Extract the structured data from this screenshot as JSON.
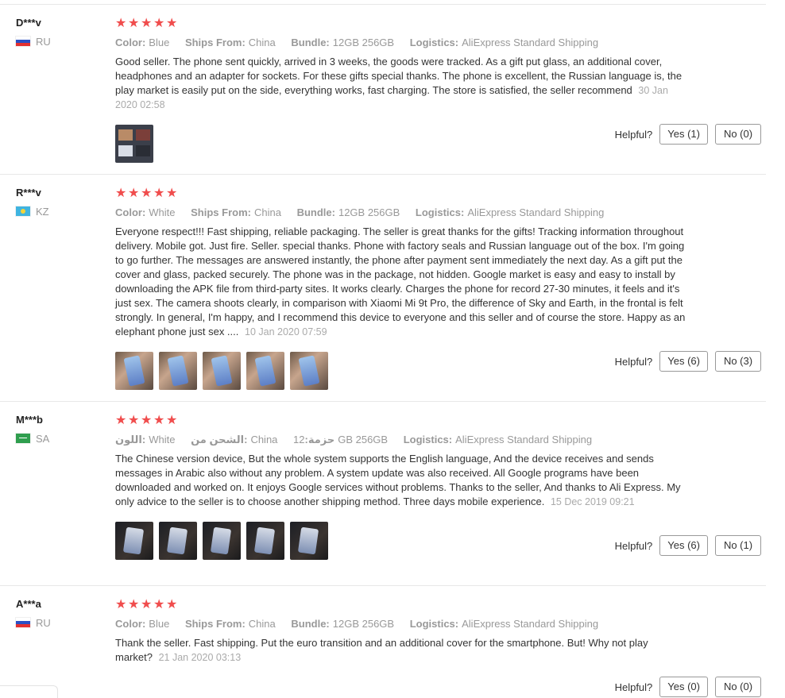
{
  "helpful_label": "Helpful?",
  "stars_glyph": "★",
  "reviews": [
    {
      "user": "D***v",
      "country": "RU",
      "flag": "russia-flag",
      "meta": [
        {
          "key": "Color:",
          "value": "Blue"
        },
        {
          "key": "Ships From:",
          "value": "China"
        },
        {
          "key": "Bundle:",
          "value": "12GB 256GB"
        },
        {
          "key": "Logistics:",
          "value": "AliExpress Standard Shipping"
        }
      ],
      "text": "Good seller. The phone sent quickly, arrived in 3 weeks, the goods were tracked. As a gift put glass, an additional cover, headphones and an adapter for sockets. For these gifts special thanks. The phone is excellent, the Russian language is, the play market is easily put on the side, everything works, fast charging. The store is satisfied, the seller recommend",
      "date": "30 Jan 2020 02:58",
      "photos": 1,
      "yes": "Yes (1)",
      "no": "No (0)"
    },
    {
      "user": "R***v",
      "country": "KZ",
      "flag": "kazakhstan-flag",
      "meta": [
        {
          "key": "Color:",
          "value": "White"
        },
        {
          "key": "Ships From:",
          "value": "China"
        },
        {
          "key": "Bundle:",
          "value": "12GB 256GB"
        },
        {
          "key": "Logistics:",
          "value": "AliExpress Standard Shipping"
        }
      ],
      "text": "Everyone respect!!! Fast shipping, reliable packaging. The seller is great thanks for the gifts! Tracking information throughout delivery. Mobile got. Just fire. Seller. special thanks. Phone with factory seals and Russian language out of the box. I'm going to go further. The messages are answered instantly, the phone after payment sent immediately the next day. As a gift put the cover and glass, packed securely. The phone was in the package, not hidden. Google market is easy and easy to install by downloading the APK file from third-party sites. It works clearly. Charges the phone for record 27-30 minutes, it feels and it's just sex. The camera shoots clearly, in comparison with Xiaomi Mi 9t Pro, the difference of Sky and Earth, in the frontal is felt strongly. In general, I'm happy, and I recommend this device to everyone and this seller and of course the store. Happy as an elephant phone just sex ....",
      "date": "10 Jan 2020 07:59",
      "photos": 5,
      "yes": "Yes (6)",
      "no": "No (3)"
    },
    {
      "user": "M***b",
      "country": "SA",
      "flag": "saudi-arabia-flag",
      "meta": [
        {
          "key": "اللون:",
          "value": "White"
        },
        {
          "key": "الشحن من:",
          "value": "China"
        },
        {
          "key": "حزمة:",
          "value": "12GB 256GB"
        },
        {
          "key": "Logistics:",
          "value": "AliExpress Standard Shipping"
        }
      ],
      "text": "The Chinese version device, But the whole system supports the English language, And the device receives and sends messages in Arabic also without any problem. A system update was also received. All Google programs have been downloaded and worked on. It enjoys Google services without problems. Thanks to the seller, And thanks to Ali Express. My only advice to the seller is to choose another shipping method. Three days mobile experience.",
      "date": "15 Dec 2019 09:21",
      "photos": 5,
      "yes": "Yes (6)",
      "no": "No (1)"
    },
    {
      "user": "A***a",
      "country": "RU",
      "flag": "russia-flag",
      "meta": [
        {
          "key": "Color:",
          "value": "Blue"
        },
        {
          "key": "Ships From:",
          "value": "China"
        },
        {
          "key": "Bundle:",
          "value": "12GB 256GB"
        },
        {
          "key": "Logistics:",
          "value": "AliExpress Standard Shipping"
        }
      ],
      "text": "Thank the seller. Fast shipping. Put the euro transition and an additional cover for the smartphone. But! Why not play market?",
      "date": "21 Jan 2020 03:13",
      "photos": 0,
      "yes": "Yes (0)",
      "no": "No (0)"
    }
  ]
}
